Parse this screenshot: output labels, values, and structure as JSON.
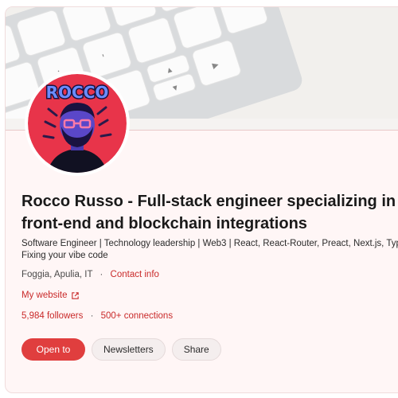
{
  "profile": {
    "name": "Rocco Russo - Full-stack engineer specializing in front-end and blockchain integrations",
    "headline": "Software Engineer | Technology leadership | Web3 | React, React-Router, Preact, Next.js, TypeScript | Fixing your vibe code",
    "location": "Foggia, Apulia, IT",
    "contact_info": "Contact info",
    "website_label": "My website",
    "followers": "5,984 followers",
    "connections": "500+ connections",
    "avatar_text": "ROCCO"
  },
  "actions": {
    "open_to": "Open to",
    "newsletters": "Newsletters",
    "share": "Share"
  },
  "colors": {
    "accent": "#e03e3e",
    "link": "#c92a2a",
    "card_background": "#fff6f6",
    "avatar_background": "#e8344a"
  },
  "icons": {
    "external_link": "external-link-icon"
  }
}
